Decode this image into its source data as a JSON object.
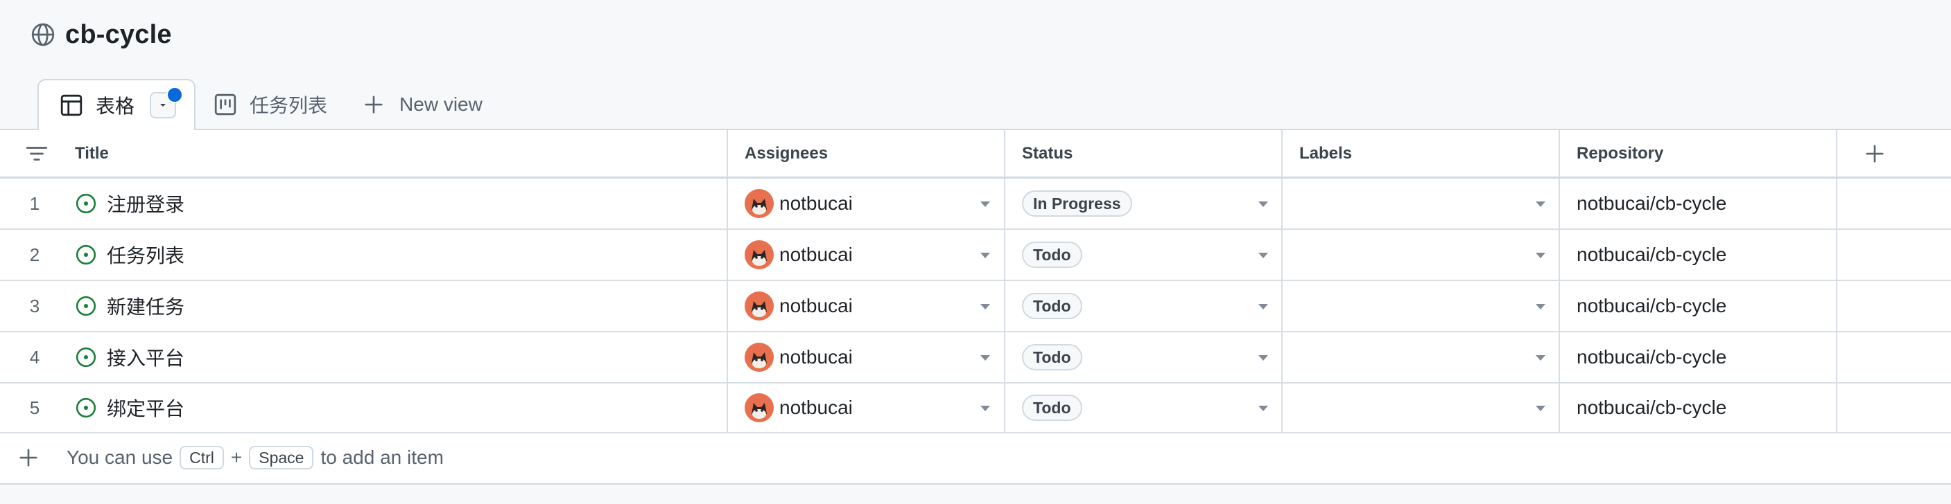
{
  "header": {
    "title": "cb-cycle",
    "icon": "globe-icon"
  },
  "tabs": [
    {
      "label": "表格",
      "icon": "table-icon",
      "active": true,
      "unsaved": true
    },
    {
      "label": "任务列表",
      "icon": "board-icon",
      "active": false
    },
    {
      "label": "New view",
      "icon": "plus-icon",
      "active": false
    }
  ],
  "table": {
    "columns": {
      "title": "Title",
      "assignees": "Assignees",
      "status": "Status",
      "labels": "Labels",
      "repository": "Repository"
    },
    "rows": [
      {
        "num": "1",
        "title": "注册登录",
        "assignee": "notbucai",
        "status": "In Progress",
        "labels": "",
        "repository": "notbucai/cb-cycle"
      },
      {
        "num": "2",
        "title": "任务列表",
        "assignee": "notbucai",
        "status": "Todo",
        "labels": "",
        "repository": "notbucai/cb-cycle"
      },
      {
        "num": "3",
        "title": "新建任务",
        "assignee": "notbucai",
        "status": "Todo",
        "labels": "",
        "repository": "notbucai/cb-cycle"
      },
      {
        "num": "4",
        "title": "接入平台",
        "assignee": "notbucai",
        "status": "Todo",
        "labels": "",
        "repository": "notbucai/cb-cycle"
      },
      {
        "num": "5",
        "title": "绑定平台",
        "assignee": "notbucai",
        "status": "Todo",
        "labels": "",
        "repository": "notbucai/cb-cycle"
      }
    ]
  },
  "footer": {
    "hint_prefix": "You can use",
    "key1": "Ctrl",
    "plus": "+",
    "key2": "Space",
    "hint_suffix": "to add an item"
  },
  "colors": {
    "accent": "#0969da",
    "open_issue": "#1a7f37",
    "avatar_bg": "#e8704f",
    "border": "#d1d9e0"
  }
}
